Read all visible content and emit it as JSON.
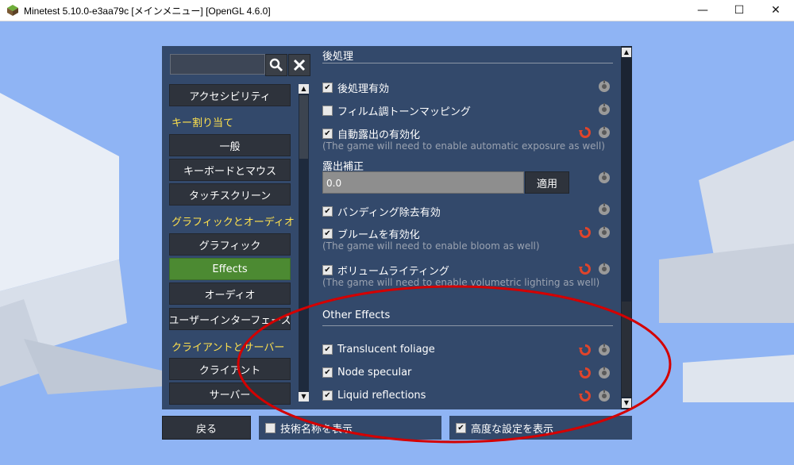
{
  "window": {
    "title": "Minetest 5.10.0-e3aa79c [メインメニュー] [OpenGL 4.6.0]",
    "minimize": "—",
    "maximize": "☐",
    "close": "✕"
  },
  "search": {
    "value": "",
    "search_glyph": "🔍",
    "clear_glyph": "✖"
  },
  "nav": {
    "items": [
      {
        "label": "アクセシビリティ",
        "type": "item"
      },
      {
        "label": "キー割り当て",
        "type": "category"
      },
      {
        "label": "一般",
        "type": "item"
      },
      {
        "label": "キーボードとマウス",
        "type": "item"
      },
      {
        "label": "タッチスクリーン",
        "type": "item"
      },
      {
        "label": "グラフィックとオーディオ",
        "type": "category"
      },
      {
        "label": "グラフィック",
        "type": "item"
      },
      {
        "label": "Effects",
        "type": "item",
        "active": true
      },
      {
        "label": "オーディオ",
        "type": "item"
      },
      {
        "label": "ユーザーインターフェース",
        "type": "item"
      },
      {
        "label": "クライアントとサーバー",
        "type": "category"
      },
      {
        "label": "クライアント",
        "type": "item"
      },
      {
        "label": "サーバー",
        "type": "item"
      }
    ],
    "scroll_up": "▲",
    "scroll_down": "▼"
  },
  "panel": {
    "section1": "後処理",
    "s_post": "後処理有効",
    "s_film": "フィルム調トーンマッピング",
    "s_autoexp": "自動露出の有効化",
    "s_autoexp_hint": "(The game will need to enable automatic exposure as well)",
    "s_exposure": "露出補正",
    "s_exposure_value": "0.0",
    "s_apply": "適用",
    "s_debanding": "バンディング除去有効",
    "s_bloom": "ブルームを有効化",
    "s_bloom_hint": "(The game will need to enable bloom as well)",
    "s_volumetric": "ボリュームライティング",
    "s_volumetric_hint": "(The game will need to enable volumetric lighting as well)",
    "section2": "Other Effects",
    "s_foliage": "Translucent foliage",
    "s_specular": "Node specular",
    "s_liquid": "Liquid reflections",
    "check": "✔",
    "scroll_up": "▲",
    "scroll_down": "▼"
  },
  "bottom": {
    "back": "戻る",
    "show_technical_names": "技術名称を表示",
    "show_advanced": "高度な設定を表示"
  },
  "colors": {
    "accent_active": "#4c8a32",
    "category_text": "#ffe14d",
    "reset_icon": "#e0442b",
    "annotation": "#d40000"
  }
}
